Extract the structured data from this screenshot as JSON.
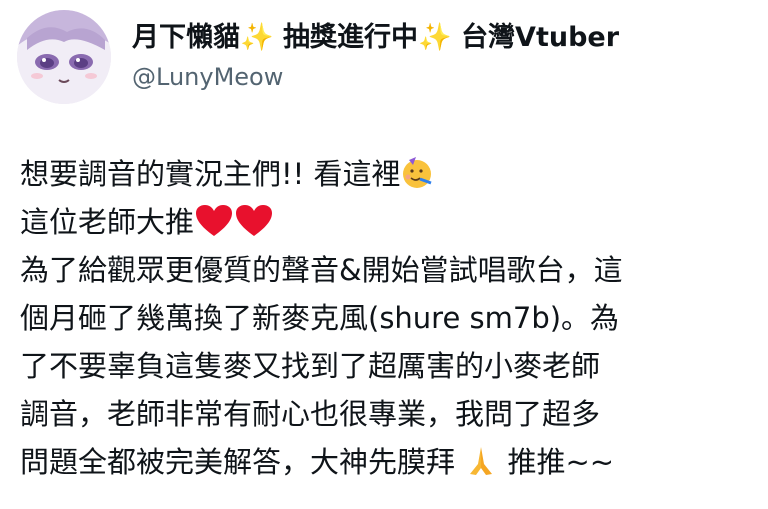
{
  "author": {
    "name_part1": "月下懶貓",
    "name_part2": "抽獎進行中",
    "name_part3": "台灣Vtuber",
    "handle": "@LunyMeow",
    "sparkle": "✨"
  },
  "tweet": {
    "lines": [
      "想要調音的實況主們!! 看這裡",
      "這位老師大推",
      "為了給觀眾更優質的聲音&開始嘗試唱歌台，這",
      "個月砸了幾萬換了新麥克風(shure sm7b)。為",
      "了不要辜負這隻麥又找到了超厲害的小麥老師",
      "調音，老師非常有耐心也很專業，我問了超多",
      "問題全都被完美解答，大神先膜拜",
      "推推~~"
    ]
  },
  "icons": {
    "party_face": "party-face-emoji",
    "heart": "red-heart-emoji",
    "pray": "folded-hands-emoji",
    "sparkles": "sparkles-emoji"
  }
}
